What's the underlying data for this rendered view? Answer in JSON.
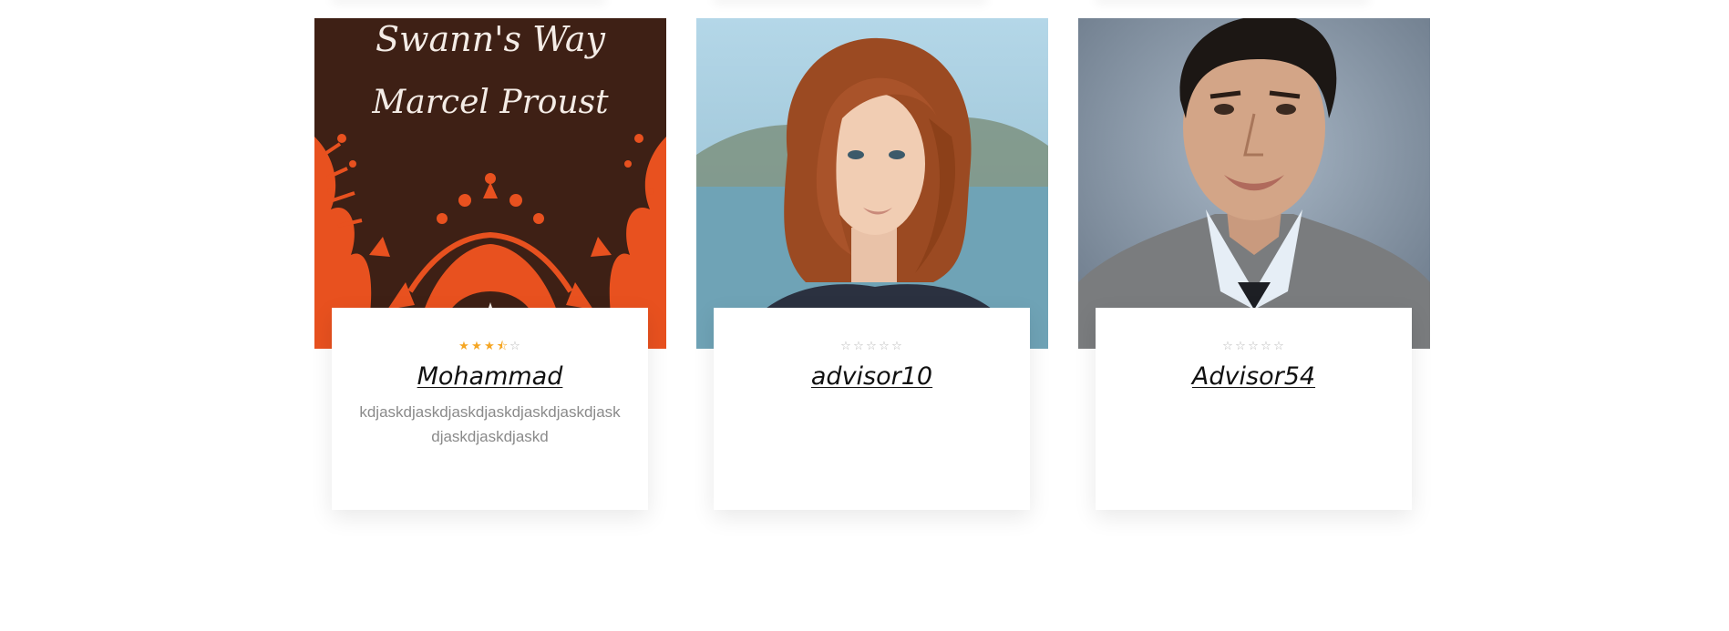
{
  "advisors": [
    {
      "name": "Mohammad",
      "rating": 3.5,
      "rating_max": 5,
      "bio": "kdjaskdjaskdjaskdjaskdjaskdjaskdjaskdjaskdjaskdjaskd",
      "image_subject": "book-cover",
      "image_text": {
        "title": "Swann's Way",
        "author": "Marcel Proust"
      }
    },
    {
      "name": "advisor10",
      "rating": 0,
      "rating_max": 5,
      "bio": "",
      "image_subject": "portrait-woman-red-hair"
    },
    {
      "name": "Advisor54",
      "rating": 0,
      "rating_max": 5,
      "bio": "",
      "image_subject": "portrait-man-smiling"
    }
  ],
  "colors": {
    "star_filled": "#f5a623",
    "star_empty": "#b8b8b8",
    "name_text": "#111111",
    "bio_text": "#8a8a8a",
    "book_cover_bg": "#3e2015",
    "book_cover_ornament": "#e8511f"
  }
}
